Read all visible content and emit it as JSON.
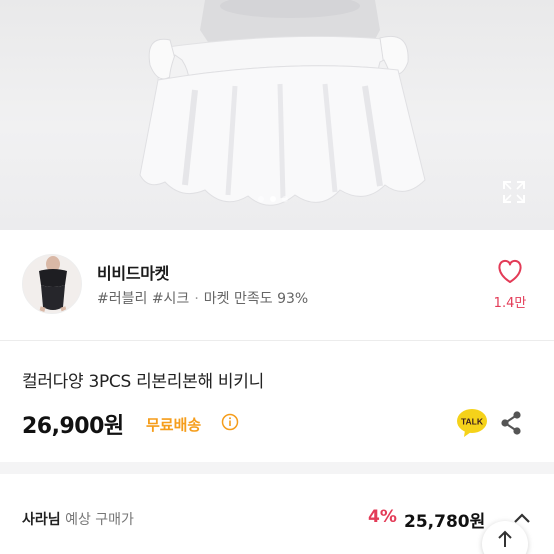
{
  "product_image": {
    "image_count": 3,
    "active_index": 1
  },
  "seller": {
    "name": "비비드마켓",
    "tags": "#러블리 #시크",
    "satisfaction": "마켓 만족도 93%",
    "separator": "·",
    "like_count": "1.4만"
  },
  "product": {
    "title": "컬러다양 3PCS 리본리본해 비키니",
    "price": "26,900원",
    "shipping_label": "무료배송"
  },
  "member_price": {
    "label_name": "사라님",
    "label_rest": " 예상 구매가",
    "discount": "4%",
    "price": "25,780원"
  },
  "colors": {
    "accent_red": "#e33b57",
    "shipping_orange": "#f59d1b",
    "talk_yellow": "#f5d21a"
  },
  "icons": {
    "expand": "expand-icon",
    "like": "heart-icon",
    "info": "info-icon",
    "talk": "talk-icon",
    "share": "share-icon",
    "chevron": "chevron-up-icon",
    "scroll_top": "arrow-up-icon"
  }
}
